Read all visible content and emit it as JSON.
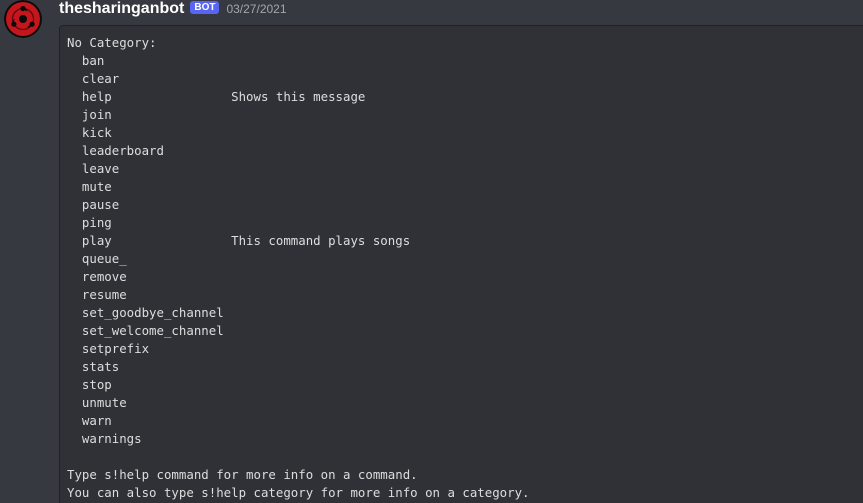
{
  "message": {
    "username": "thesharinganbot",
    "bot_tag": "BOT",
    "timestamp": "03/27/2021",
    "avatar_icon": "sharingan-avatar-icon",
    "colors": {
      "background": "#36393f",
      "codeblock_background": "#2f3136",
      "bot_tag": "#5865f2",
      "avatar_red": "#c4161c"
    },
    "code_lines": [
      "No Category:",
      "  ban",
      "  clear",
      "  help                Shows this message",
      "  join",
      "  kick",
      "  leaderboard",
      "  leave",
      "  mute",
      "  pause",
      "  ping",
      "  play                This command plays songs",
      "  queue_",
      "  remove",
      "  resume",
      "  set_goodbye_channel",
      "  set_welcome_channel",
      "  setprefix",
      "  stats",
      "  stop",
      "  unmute",
      "  warn",
      "  warnings",
      "",
      "Type s!help command for more info on a command.",
      "You can also type s!help category for more info on a category."
    ]
  }
}
